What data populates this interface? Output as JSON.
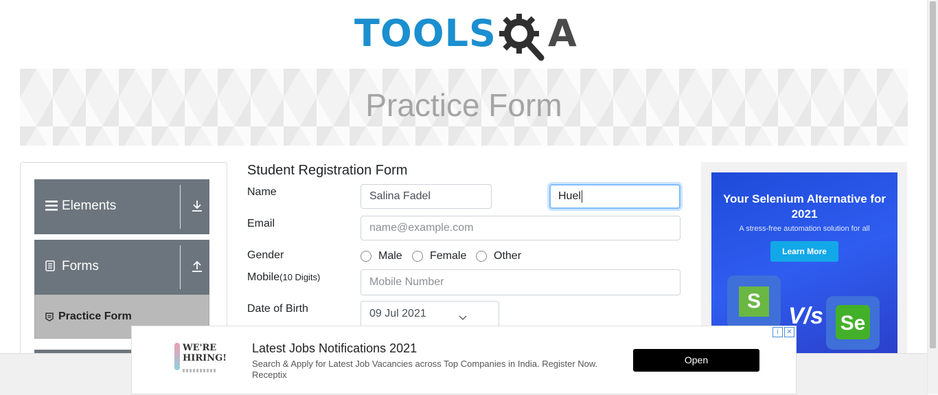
{
  "logo": {
    "main": "TOOLS",
    "suffix": "A"
  },
  "banner": {
    "title": "Practice Form"
  },
  "sidebar": {
    "groups": [
      {
        "label": "Elements",
        "toggle": "download-arrow"
      },
      {
        "label": "Forms",
        "toggle": "upload-arrow"
      }
    ],
    "active_item": {
      "label": "Practice Form"
    }
  },
  "form": {
    "title": "Student Registration Form",
    "name_label": "Name",
    "first_name_value": "Salina Fadel",
    "last_name_value": "Huel",
    "email_label": "Email",
    "email_placeholder": "name@example.com",
    "gender_label": "Gender",
    "gender_options": [
      "Male",
      "Female",
      "Other"
    ],
    "mobile_label": "Mobile",
    "mobile_hint": "(10 Digits)",
    "mobile_placeholder": "Mobile Number",
    "dob_label": "Date of Birth",
    "dob_value": "09 Jul 2021"
  },
  "ad_right": {
    "headline": "Your Selenium Alternative for 2021",
    "sub": "A stress-free automation solution for all",
    "button": "Learn More",
    "left_badge": "S",
    "vs": "V/s",
    "right_badge": "Se"
  },
  "bottom_ad": {
    "image_text": "WE'RE HIRING!",
    "title": "Latest Jobs Notifications 2021",
    "description": "Search & Apply for Latest Job Vacancies across Top Companies in India. Register Now.",
    "advertiser": "Receptix",
    "button": "Open"
  },
  "colors": {
    "brand_blue": "#1b8fcf",
    "sidebar_gray": "#6c757d",
    "focus_border": "#80bdff"
  }
}
